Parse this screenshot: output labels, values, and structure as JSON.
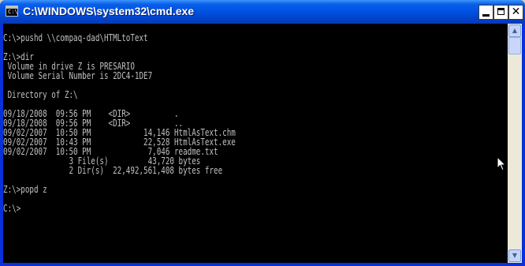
{
  "window": {
    "title": "C:\\WINDOWS\\system32\\cmd.exe",
    "icon_text": "C:\\",
    "minimize_glyph": "",
    "close_glyph": "✕"
  },
  "console": {
    "text_color": "#c0c0c0",
    "background_color": "#000000",
    "lines": [
      "C:\\>pushd \\\\compaq-dad\\HTMLtoText",
      "",
      "Z:\\>dir",
      " Volume in drive Z is PRESARIO",
      " Volume Serial Number is 2DC4-1DE7",
      "",
      " Directory of Z:\\",
      "",
      "09/18/2008  09:56 PM    <DIR>          .",
      "09/18/2008  09:56 PM    <DIR>          ..",
      "09/02/2007  10:50 PM            14,146 HtmlAsText.chm",
      "09/02/2007  10:43 PM            22,528 HtmlAsText.exe",
      "09/02/2007  10:50 PM             7,046 readme.txt",
      "               3 File(s)         43,720 bytes",
      "               2 Dir(s)  22,492,561,408 bytes free",
      "",
      "Z:\\>popd z",
      "",
      "C:\\>"
    ]
  },
  "scrollbar": {
    "up_glyph": "▲",
    "down_glyph": "▼"
  },
  "colors": {
    "titlebar": "#0054e3",
    "frame": "#0831d9"
  }
}
